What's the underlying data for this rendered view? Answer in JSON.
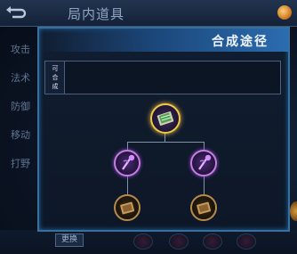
{
  "background": {
    "title": "局内道具",
    "side_menu": [
      "攻击",
      "法术",
      "防御",
      "移动",
      "打野"
    ],
    "bottom_button": "更换"
  },
  "panel": {
    "title": "合成途径",
    "craft_label": "可合成"
  },
  "items": {
    "root": {
      "icon": "spellbook-icon",
      "tier": "gold"
    },
    "left": {
      "icon": "purple-staff-icon",
      "tier": "purple"
    },
    "right": {
      "icon": "purple-staff-icon",
      "tier": "purple"
    },
    "left_child": {
      "icon": "brown-book-icon",
      "tier": "basic"
    },
    "right_child": {
      "icon": "brown-book-icon",
      "tier": "basic"
    }
  },
  "colors": {
    "accent_blue": "#2b6cb0",
    "gold_border": "#f0c84a",
    "purple_border": "#c47fe0",
    "brown_border": "#b68a4e"
  }
}
